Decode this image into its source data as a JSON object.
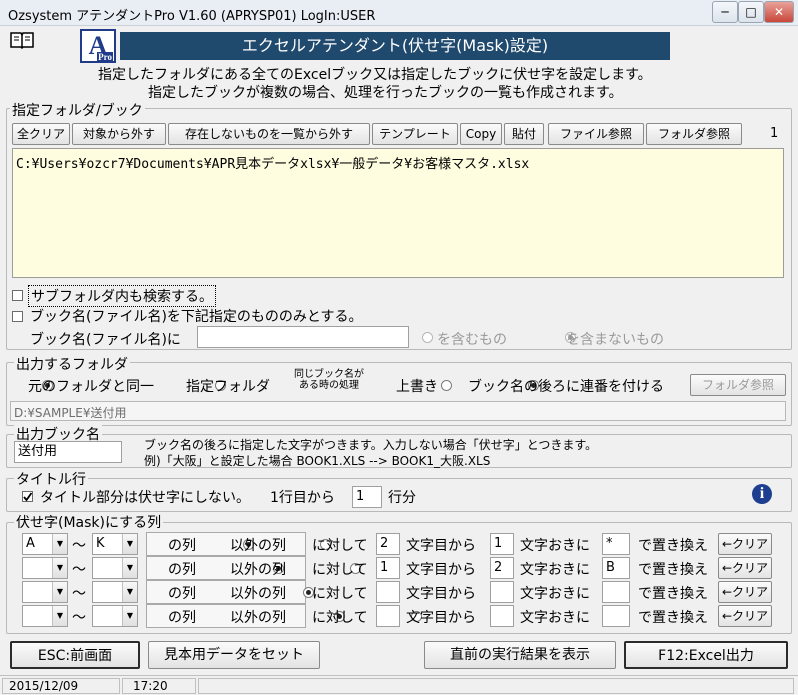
{
  "window": {
    "title": "Ozsystem アテンダントPro V1.60 (APRYSP01)  LogIn:USER",
    "minimize": "─",
    "maximize": "□",
    "close": "✕"
  },
  "header": {
    "logo_letter": "A",
    "logo_sub": "Pro",
    "title": "エクセルアテンダント(伏せ字(Mask)設定)",
    "desc1": "指定したフォルダにある全てのExcelブック又は指定したブックに伏せ字を設定します。",
    "desc2": "指定したブックが複数の場合、処理を行ったブックの一覧も作成されます。"
  },
  "folder_section": {
    "label": "指定フォルダ/ブック",
    "buttons": [
      "全クリア",
      "対象から外す",
      "存在しないものを一覧から外す",
      "テンプレート",
      "Copy",
      "貼付",
      "ファイル参照",
      "フォルダ参照"
    ],
    "count": "1",
    "path": "C:¥Users¥ozcr7¥Documents¥APR見本データxlsx¥一般データ¥お客様マスタ.xlsx",
    "subfolder": "サブフォルダ内も検索する。",
    "book_filter": "ブック名(ファイル名)を下記指定のもののみとする。",
    "book_name_label": "ブック名(ファイル名)に",
    "book_name_value": "",
    "contains": "を含むもの",
    "not_contains": "を含まないもの"
  },
  "output_section": {
    "label": "出力するフォルダ",
    "same_folder": "元のフォルダと同一",
    "specified_folder": "指定フォルダ",
    "same_name_label": "同じブック名が ある時の処理",
    "overwrite": "上書き",
    "serial": "ブック名の後ろに連番を付ける",
    "folder_btn": "フォルダ参照",
    "path": "D:¥SAMPLE¥送付用"
  },
  "output_book": {
    "label": "出力ブック名",
    "value": "送付用",
    "note1": "ブック名の後ろに指定した文字がつきます。入力しない場合「伏せ字」とつきます。",
    "note2": "例)「大阪」と設定した場合  BOOK1.XLS --> BOOK1_大阪.XLS"
  },
  "title_row": {
    "label": "タイトル行",
    "checkbox": "タイトル部分は伏せ字にしない。",
    "from_label": "1行目から",
    "rows": "1",
    "rows_unit": "行分",
    "info": "i"
  },
  "mask_section": {
    "label": "伏せ字(Mask)にする列",
    "tilde": "～",
    "this_col": "の列",
    "other_col": "以外の列",
    "against": "に対して",
    "from_char": "文字目から",
    "every": "文字おきに",
    "replace": "で置き換え",
    "clear": "←クリア",
    "rows": [
      {
        "from": "A",
        "to": "K",
        "start": "2",
        "interval": "1",
        "char": "*"
      },
      {
        "from": "",
        "to": "",
        "start": "1",
        "interval": "2",
        "char": "B"
      },
      {
        "from": "",
        "to": "",
        "start": "",
        "interval": "",
        "char": ""
      },
      {
        "from": "",
        "to": "",
        "start": "",
        "interval": "",
        "char": ""
      }
    ]
  },
  "footer": {
    "esc": "ESC:前画面",
    "sample": "見本用データをセット",
    "prev": "直前の実行結果を表示",
    "f12": "F12:Excel出力"
  },
  "status": {
    "date": "2015/12/09",
    "time": "17:20"
  }
}
